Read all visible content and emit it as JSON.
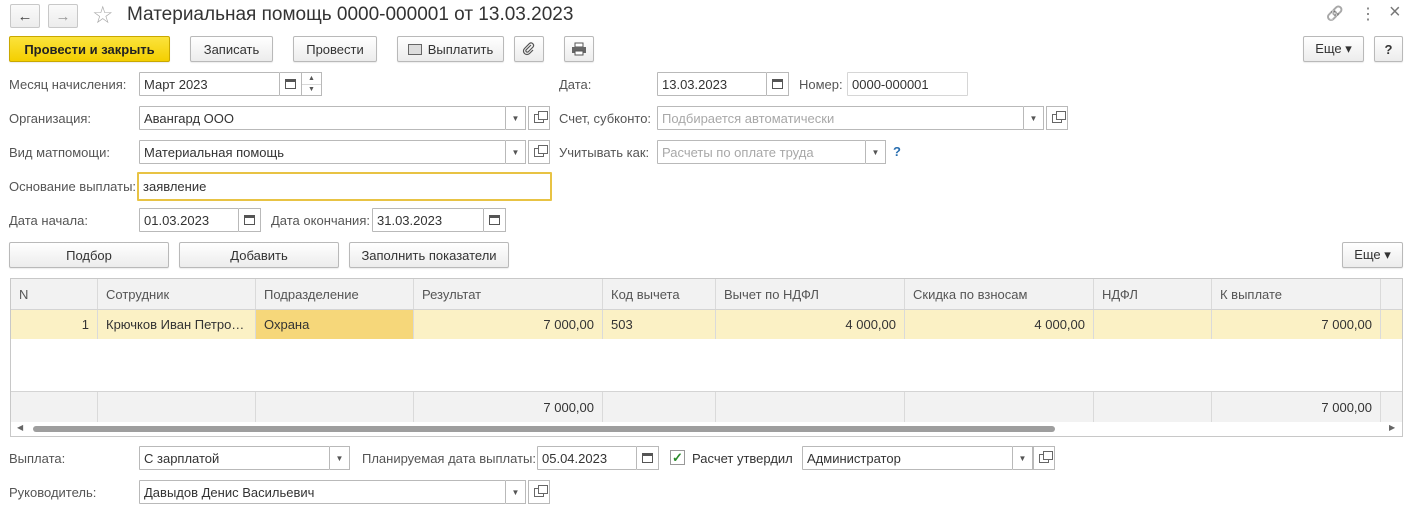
{
  "header": {
    "title": "Материальная помощь 0000-000001 от 13.03.2023",
    "back_icon": "←",
    "forward_icon": "→",
    "star_icon": "☆",
    "link_icon": "🔗",
    "more_icon": "⋮",
    "close_icon": "×"
  },
  "toolbar": {
    "post_close": "Провести и закрыть",
    "save": "Записать",
    "post": "Провести",
    "pay": "Выплатить",
    "more": "Еще ▾",
    "help": "?"
  },
  "form": {
    "month_label": "Месяц начисления:",
    "month_value": "Март 2023",
    "date_label": "Дата:",
    "date_value": "13.03.2023",
    "number_label": "Номер:",
    "number_value": "0000-000001",
    "org_label": "Организация:",
    "org_value": "Авангард ООО",
    "account_label": "Счет, субконто:",
    "account_placeholder": "Подбирается автоматически",
    "aid_type_label": "Вид матпомощи:",
    "aid_type_value": "Материальная помощь",
    "account_as_label": "Учитывать как:",
    "account_as_placeholder": "Расчеты по оплате труда",
    "account_as_help": "?",
    "basis_label": "Основание выплаты:",
    "basis_value": "заявление",
    "start_label": "Дата начала:",
    "start_value": "01.03.2023",
    "end_label": "Дата окончания:",
    "end_value": "31.03.2023"
  },
  "table_toolbar": {
    "pick": "Подбор",
    "add": "Добавить",
    "fill": "Заполнить показатели",
    "more": "Еще ▾"
  },
  "table": {
    "headers": [
      "N",
      "Сотрудник",
      "Подразделение",
      "Результат",
      "Код вычета",
      "Вычет по НДФЛ",
      "Скидка по взносам",
      "НДФЛ",
      "К выплате"
    ],
    "rows": [
      [
        "1",
        "Крючков Иван Петро…",
        "Охрана",
        "7 000,00",
        "503",
        "4 000,00",
        "4 000,00",
        "",
        "7 000,00"
      ]
    ],
    "totals": [
      "",
      "",
      "",
      "7 000,00",
      "",
      "",
      "",
      "",
      "7 000,00"
    ]
  },
  "footer": {
    "payment_label": "Выплата:",
    "payment_value": "С зарплатой",
    "planned_date_label": "Планируемая дата выплаты:",
    "planned_date_value": "05.04.2023",
    "approved_label": "Расчет утвердил",
    "approved_checked": "✓",
    "approver_value": "Администратор",
    "manager_label": "Руководитель:",
    "manager_value": "Давыдов Денис Васильевич"
  }
}
